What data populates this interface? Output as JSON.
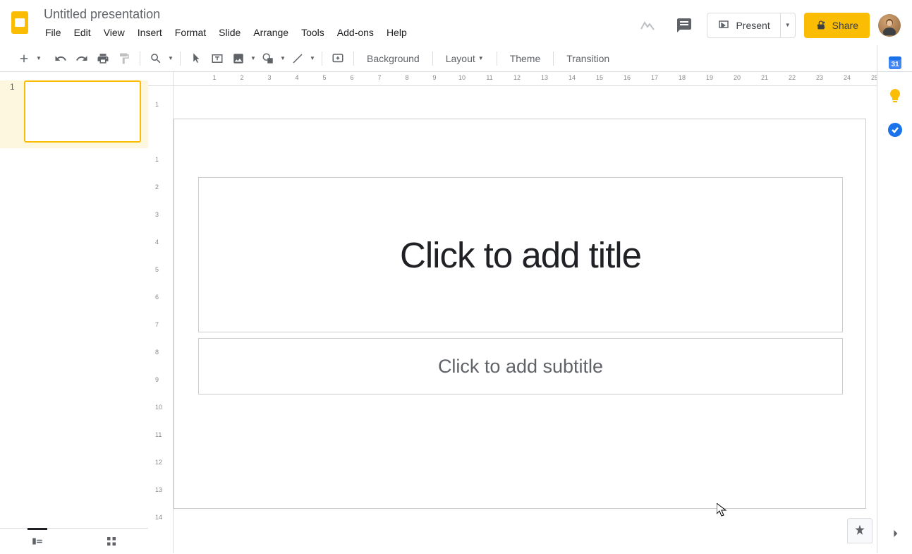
{
  "doc": {
    "title": "Untitled presentation"
  },
  "menu": {
    "items": [
      "File",
      "Edit",
      "View",
      "Insert",
      "Format",
      "Slide",
      "Arrange",
      "Tools",
      "Add-ons",
      "Help"
    ]
  },
  "header": {
    "present": "Present",
    "share": "Share"
  },
  "toolbar": {
    "background": "Background",
    "layout": "Layout",
    "theme": "Theme",
    "transition": "Transition"
  },
  "ruler": {
    "h": [
      "1",
      "",
      "1",
      "2",
      "3",
      "4",
      "5",
      "6",
      "7",
      "8",
      "9",
      "10",
      "11",
      "12",
      "13",
      "14",
      "15",
      "16",
      "17",
      "18",
      "19",
      "20",
      "21",
      "22",
      "23",
      "24",
      "25"
    ],
    "v": [
      "1",
      "",
      "1",
      "2",
      "3",
      "4",
      "5",
      "6",
      "7",
      "8",
      "9",
      "10",
      "11",
      "12",
      "13",
      "14"
    ]
  },
  "slide": {
    "number": "1",
    "title_placeholder": "Click to add title",
    "subtitle_placeholder": "Click to add subtitle"
  },
  "sidepanel": {
    "calendar": "31"
  }
}
